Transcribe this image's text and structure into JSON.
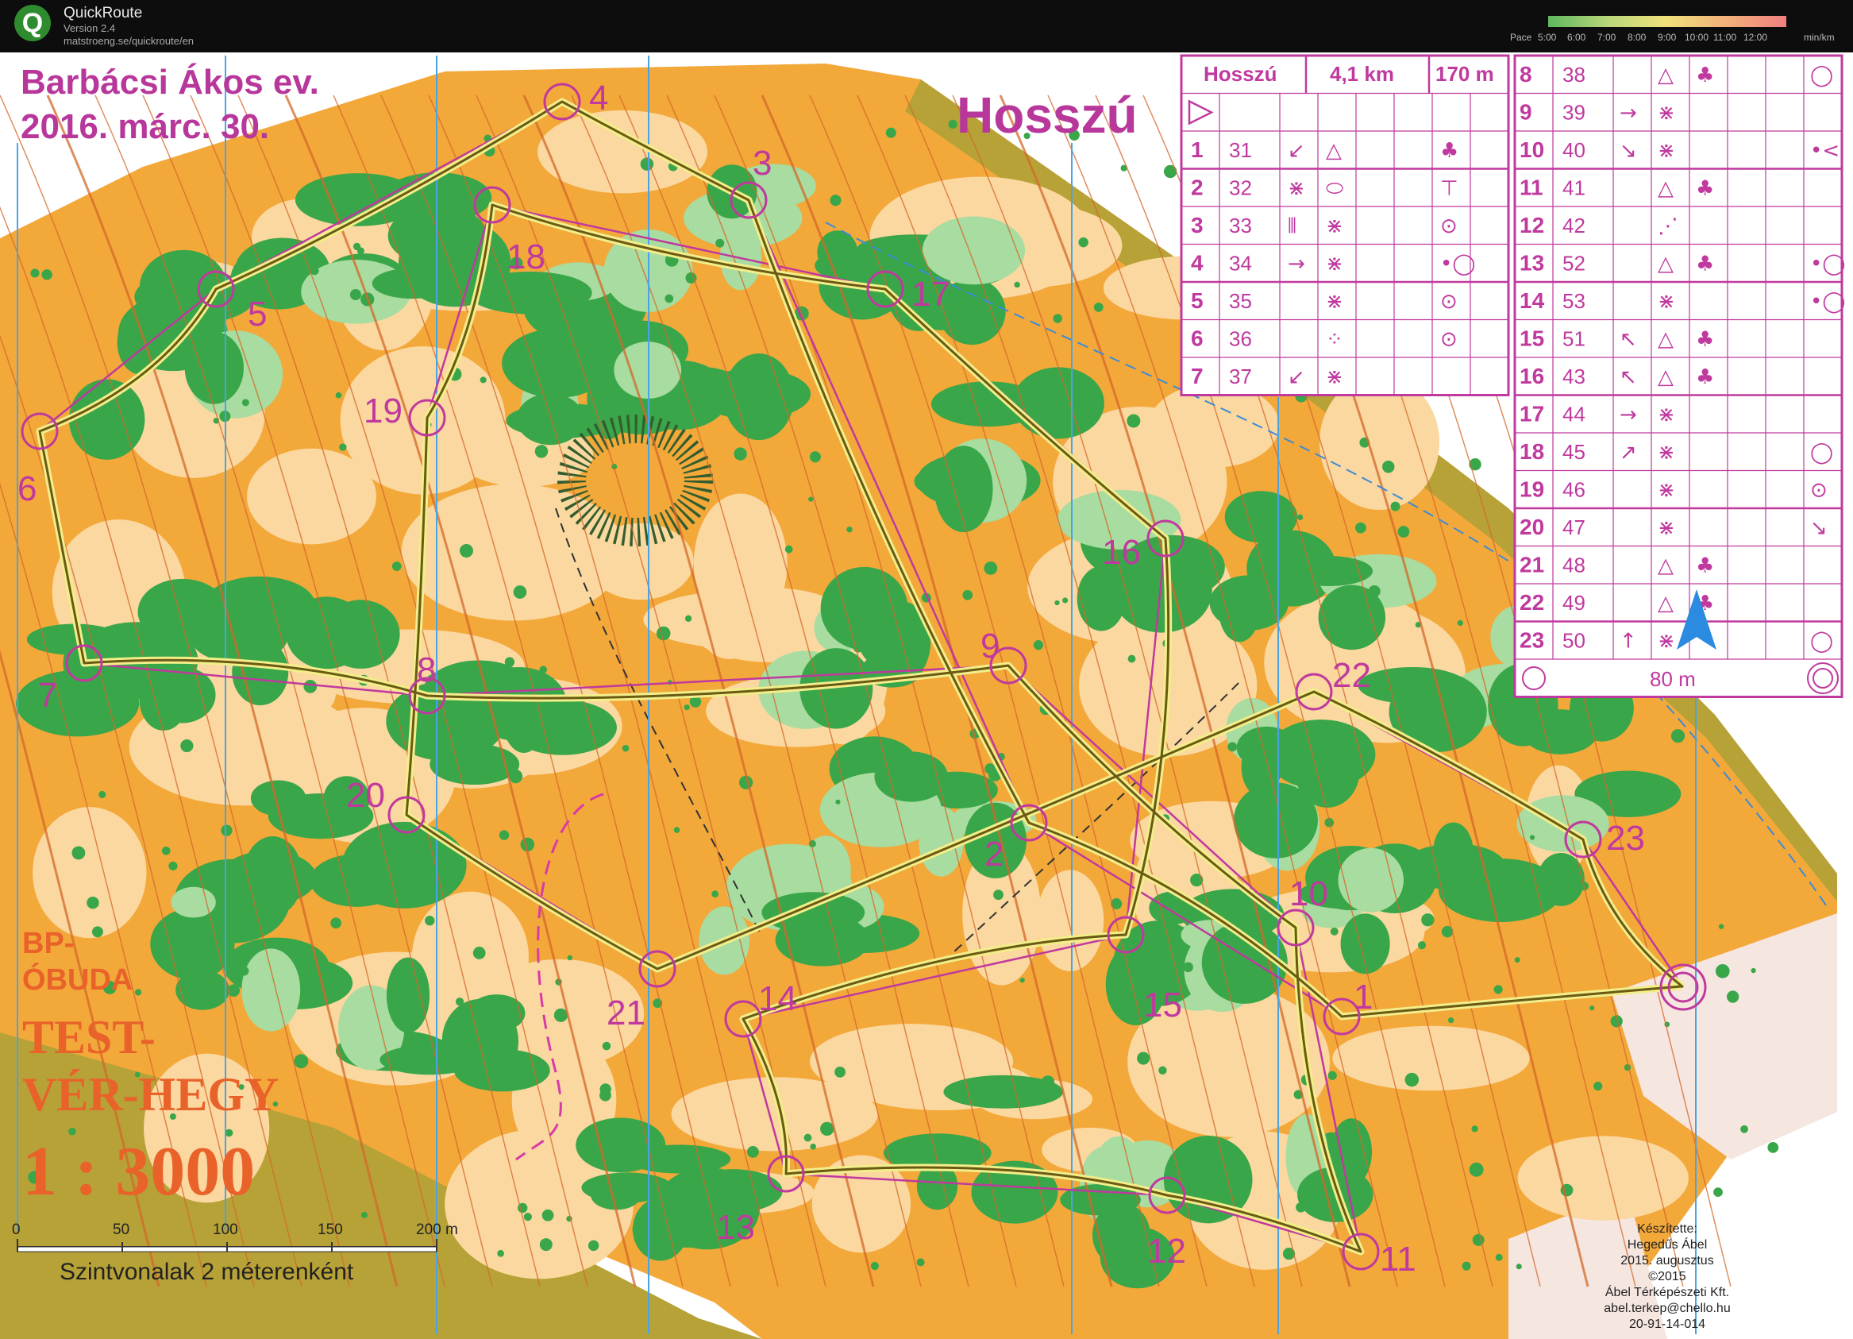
{
  "app": {
    "title": "QuickRoute",
    "version": "Version 2.4",
    "url": "matstroeng.se/quickroute/en"
  },
  "pace_legend": {
    "title": "Pace",
    "ticks": [
      "5:00",
      "6:00",
      "7:00",
      "8:00",
      "9:00",
      "10:00",
      "11:00",
      "12:00"
    ],
    "unit": "min/km"
  },
  "map": {
    "runner": "Barbácsi Ákos ev.",
    "date": "2016. márc. 30.",
    "course_name": "Hosszú",
    "club_line1": "BP-",
    "club_line2": "ÓBUDA",
    "area_line1": "TEST-",
    "area_line2": "VÉR-HEGY",
    "scale": "1 : 3000",
    "scalebar_labels": [
      "0",
      "50",
      "100",
      "150",
      "200 m"
    ],
    "contour_note": "Szintvonalak 2 méterenként",
    "credits": [
      "Készítette:",
      "Hegedűs Ábel",
      "2015. augusztus",
      "©2015",
      "Ábel Térképészeti Kft.",
      "abel.terkep@chello.hu",
      "20-91-14-014"
    ],
    "controls": [
      {
        "n": "1"
      },
      {
        "n": "2"
      },
      {
        "n": "3"
      },
      {
        "n": "4"
      },
      {
        "n": "5"
      },
      {
        "n": "6"
      },
      {
        "n": "7"
      },
      {
        "n": "8"
      },
      {
        "n": "9"
      },
      {
        "n": "10"
      },
      {
        "n": "11"
      },
      {
        "n": "12"
      },
      {
        "n": "13"
      },
      {
        "n": "14"
      },
      {
        "n": "15"
      },
      {
        "n": "16"
      },
      {
        "n": "17"
      },
      {
        "n": "18"
      },
      {
        "n": "19"
      },
      {
        "n": "20"
      },
      {
        "n": "21"
      },
      {
        "n": "22"
      },
      {
        "n": "23"
      }
    ]
  },
  "description_sheet": {
    "header": {
      "course": "Hosszú",
      "length": "4,1 km",
      "climb": "170 m"
    },
    "left_rows": [
      {
        "n": "1",
        "code": "31",
        "sym": [
          "↙",
          "△",
          "♣"
        ]
      },
      {
        "n": "2",
        "code": "32",
        "sym": [
          "⋇",
          "⬭",
          "⊤"
        ]
      },
      {
        "n": "3",
        "code": "33",
        "sym": [
          "⫴",
          "⋇",
          "⊙"
        ]
      },
      {
        "n": "4",
        "code": "34",
        "sym": [
          "→",
          "⋇",
          "•◯"
        ]
      },
      {
        "n": "5",
        "code": "35",
        "sym": [
          "",
          "⋇",
          "⊙"
        ]
      },
      {
        "n": "6",
        "code": "36",
        "sym": [
          "",
          "⁘",
          "⊙"
        ]
      },
      {
        "n": "7",
        "code": "37",
        "sym": [
          "↙",
          "⋇",
          ""
        ]
      }
    ],
    "right_rows": [
      {
        "n": "8",
        "code": "38",
        "sym": [
          "",
          "△",
          "♣",
          "◯"
        ]
      },
      {
        "n": "9",
        "code": "39",
        "sym": [
          "→",
          "⋇",
          "",
          ""
        ]
      },
      {
        "n": "10",
        "code": "40",
        "sym": [
          "↘",
          "⋇",
          "",
          "•<"
        ]
      },
      {
        "n": "11",
        "code": "41",
        "sym": [
          "",
          "△",
          "♣",
          ""
        ]
      },
      {
        "n": "12",
        "code": "42",
        "sym": [
          "",
          "⋰",
          "",
          ""
        ]
      },
      {
        "n": "13",
        "code": "52",
        "sym": [
          "",
          "△",
          "♣",
          "•◯"
        ]
      },
      {
        "n": "14",
        "code": "53",
        "sym": [
          "",
          "⋇",
          "",
          "•◯"
        ]
      },
      {
        "n": "15",
        "code": "51",
        "sym": [
          "↖",
          "△",
          "♣",
          ""
        ]
      },
      {
        "n": "16",
        "code": "43",
        "sym": [
          "↖",
          "△",
          "♣",
          ""
        ]
      },
      {
        "n": "17",
        "code": "44",
        "sym": [
          "→",
          "⋇",
          "",
          ""
        ]
      },
      {
        "n": "18",
        "code": "45",
        "sym": [
          "↗",
          "⋇",
          "",
          "◯"
        ]
      },
      {
        "n": "19",
        "code": "46",
        "sym": [
          "",
          "⋇",
          "",
          "⊙"
        ]
      },
      {
        "n": "20",
        "code": "47",
        "sym": [
          "",
          "⋇",
          "",
          "↘"
        ]
      },
      {
        "n": "21",
        "code": "48",
        "sym": [
          "",
          "△",
          "♣",
          ""
        ]
      },
      {
        "n": "22",
        "code": "49",
        "sym": [
          "",
          "△",
          "♣",
          ""
        ]
      },
      {
        "n": "23",
        "code": "50",
        "sym": [
          "↑",
          "⋇",
          "",
          "◯"
        ]
      }
    ],
    "finish_distance": "80 m"
  },
  "colors": {
    "course": "#c0399e",
    "open_land": "#f3a83a",
    "light_open": "#fbd8a0",
    "forest_green": "#3aa64a",
    "light_green": "#a8dca0",
    "contour": "#d3682a",
    "route": "#6b5a14",
    "water": "#2a7ad6"
  }
}
